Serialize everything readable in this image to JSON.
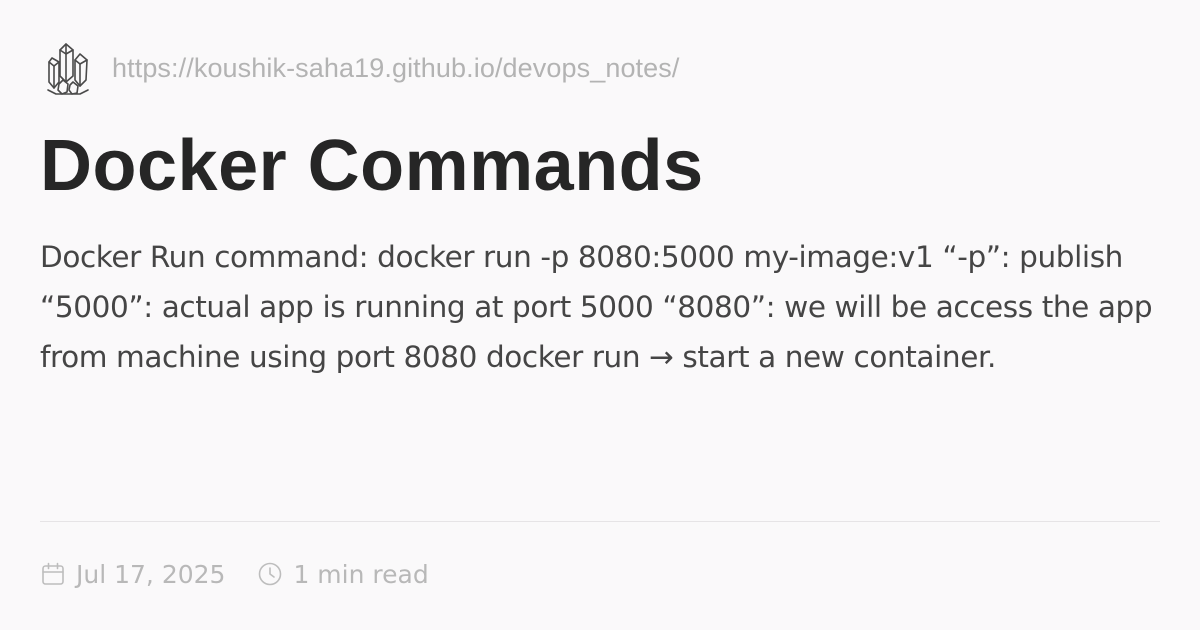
{
  "site": {
    "url": "https://koushik-saha19.github.io/devops_notes/",
    "logo_icon": "crystal-cluster-icon"
  },
  "post": {
    "title": "Docker Commands",
    "excerpt": "Docker Run command: docker run -p 8080:5000 my-image:v1 “-p”: publish “5000”: actual app is running at port 5000 “8080”: we will be access the app from machine using port 8080 docker run → start a new container."
  },
  "meta": {
    "date": "Jul 17, 2025",
    "date_icon": "calendar-icon",
    "read_time": "1 min read",
    "read_time_icon": "clock-icon"
  },
  "colors": {
    "background": "#faf9fa",
    "title": "#262626",
    "body_text": "#454545",
    "muted_text": "#b3b3b3",
    "divider": "#e6e4e6"
  }
}
